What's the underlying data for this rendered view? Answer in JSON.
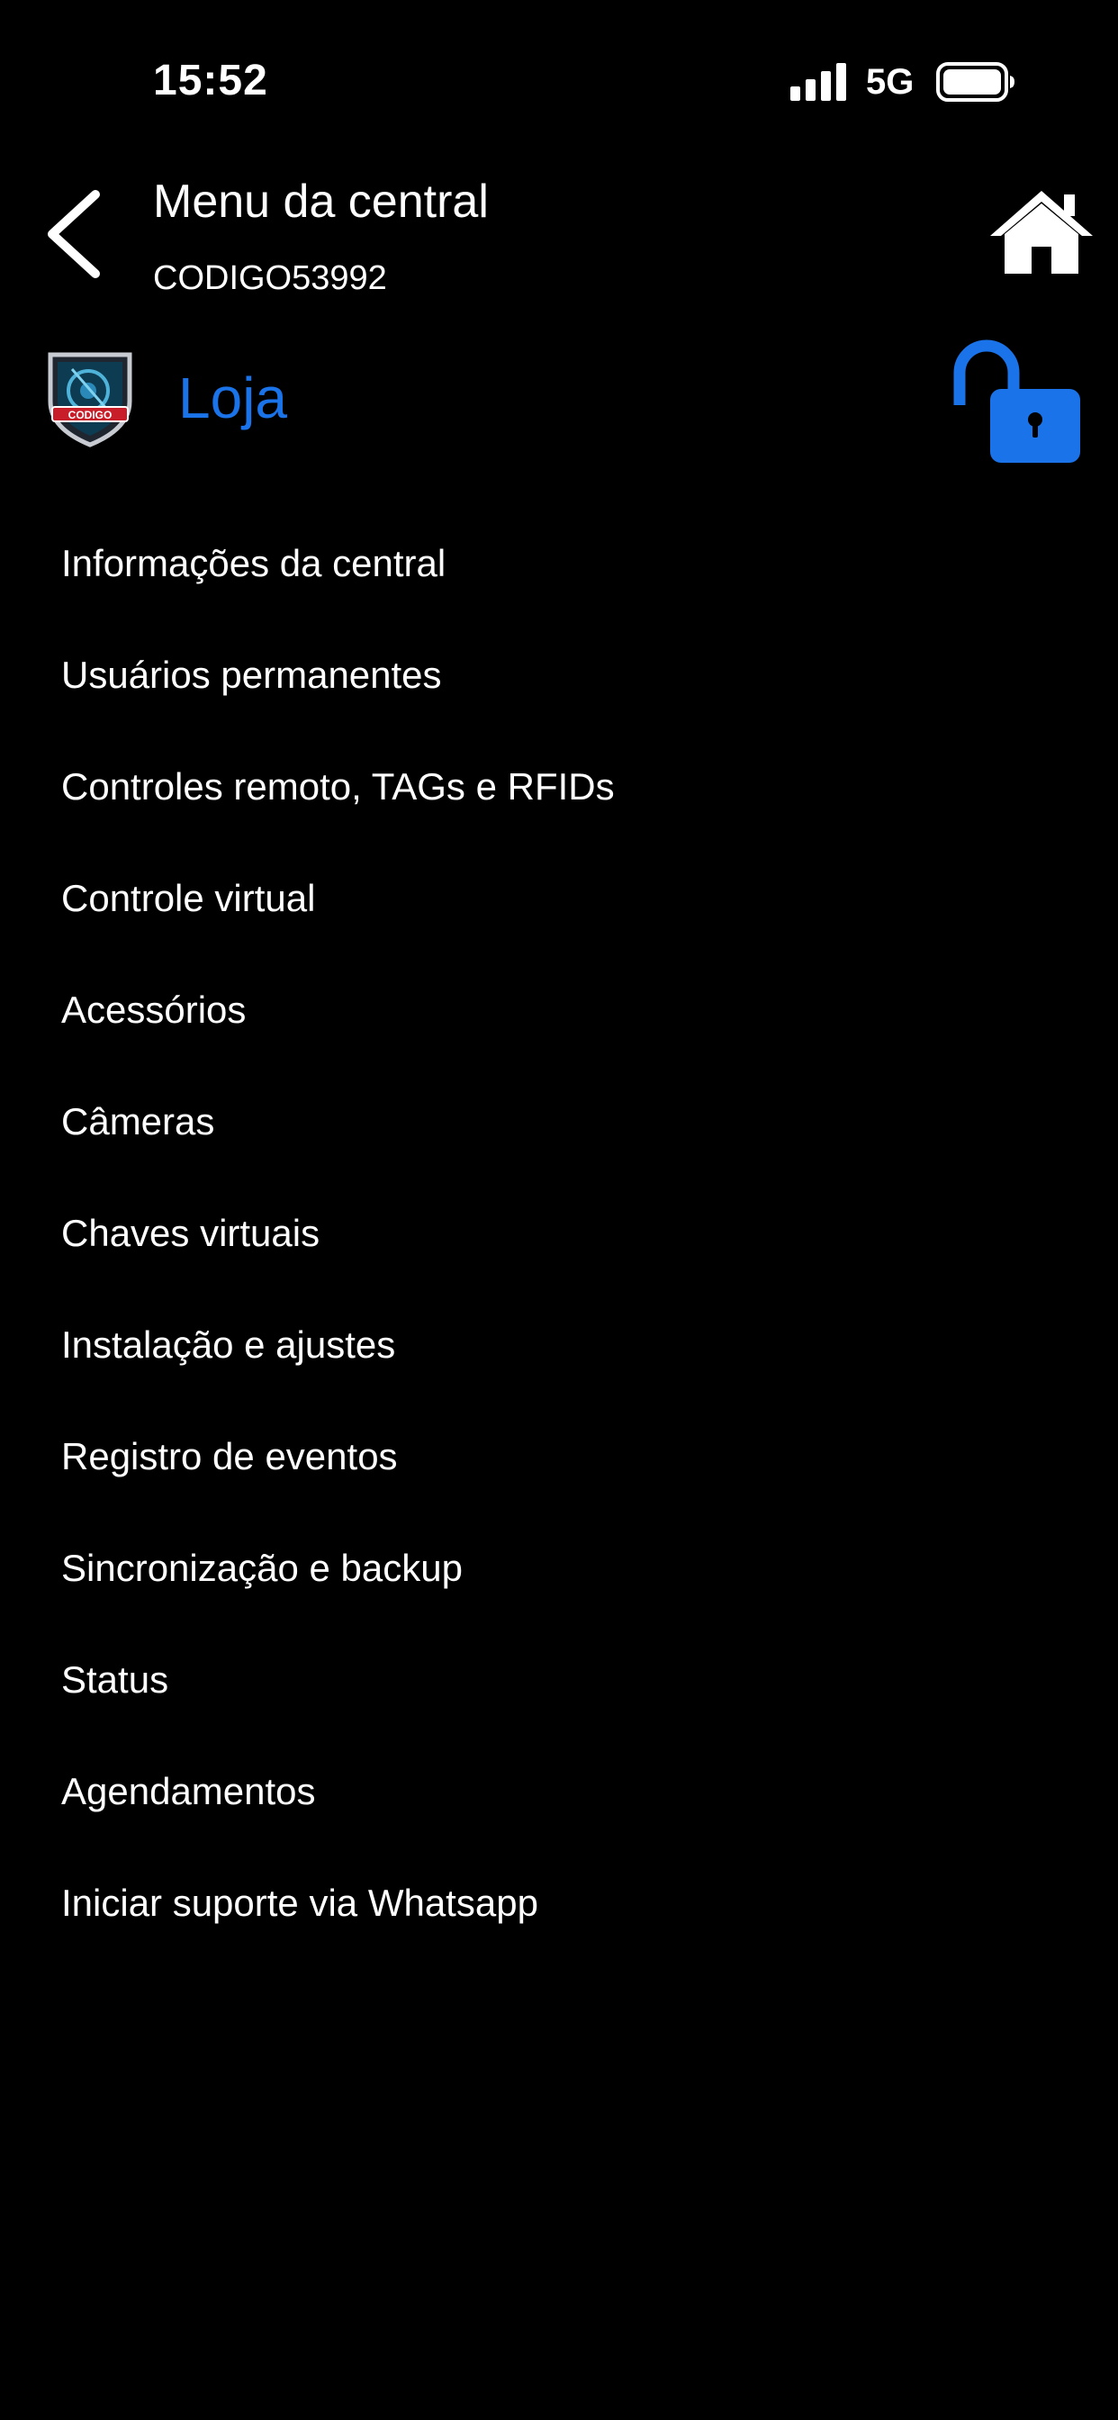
{
  "status_bar": {
    "time": "15:52",
    "network": "5G",
    "signal_icon": "cellular-signal-icon",
    "battery_icon": "battery-full-icon"
  },
  "header": {
    "title": "Menu da central",
    "subtitle": "CODIGO53992",
    "back_icon": "chevron-left-icon",
    "home_icon": "home-icon"
  },
  "device": {
    "name": "Loja",
    "logo_text": "CODIGO",
    "lock_icon": "unlocked-padlock-icon",
    "accent_color": "#1a73e8"
  },
  "menu": {
    "items": [
      {
        "label": "Informações da central"
      },
      {
        "label": "Usuários permanentes"
      },
      {
        "label": "Controles remoto, TAGs e RFIDs"
      },
      {
        "label": "Controle virtual"
      },
      {
        "label": "Acessórios"
      },
      {
        "label": "Câmeras"
      },
      {
        "label": "Chaves virtuais"
      },
      {
        "label": "Instalação e ajustes"
      },
      {
        "label": "Registro de eventos"
      },
      {
        "label": "Sincronização e backup"
      },
      {
        "label": "Status"
      },
      {
        "label": "Agendamentos"
      },
      {
        "label": "Iniciar suporte via Whatsapp"
      }
    ]
  },
  "colors": {
    "background": "#000000",
    "text": "#ffffff",
    "accent": "#1a73e8"
  }
}
